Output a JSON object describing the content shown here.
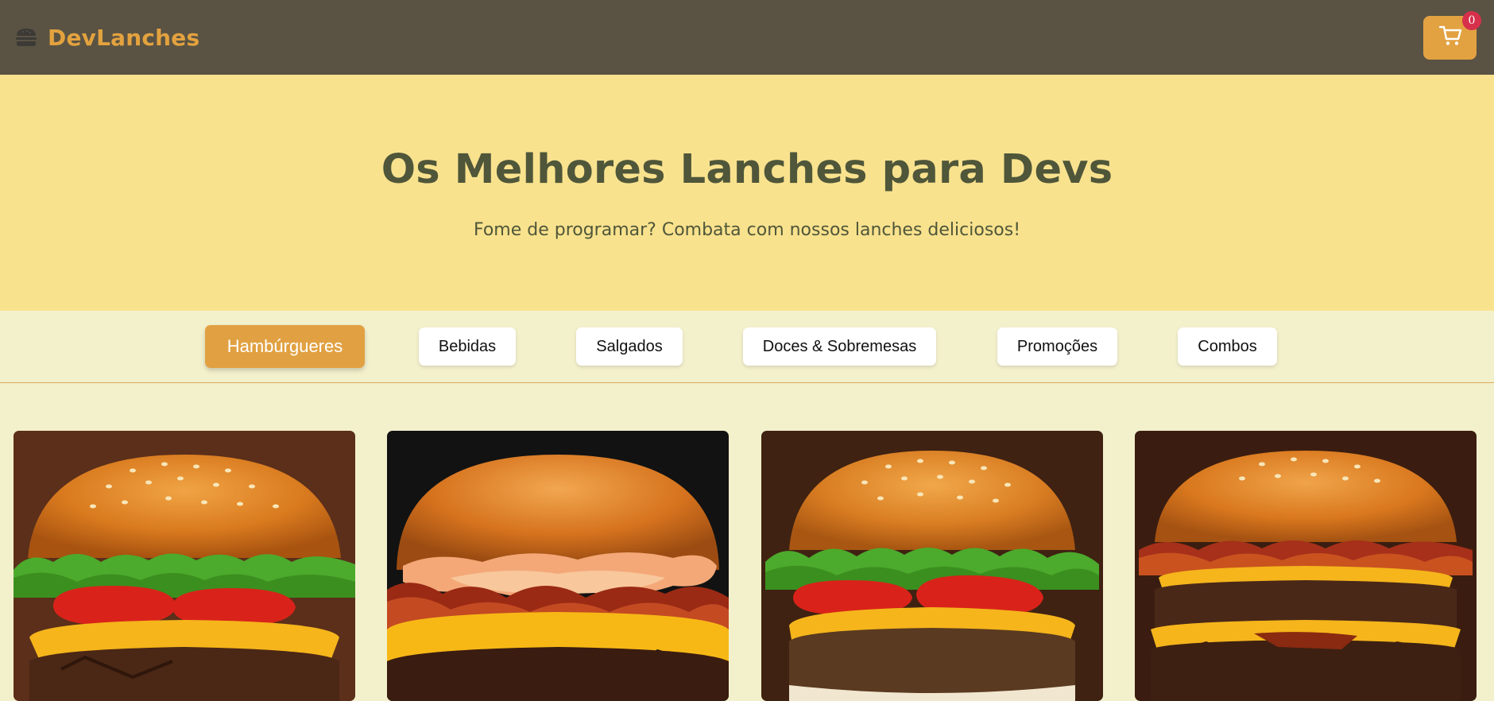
{
  "header": {
    "brand_name": "DevLanches",
    "brand_icon": "burger-icon",
    "cart_icon": "cart-icon",
    "cart_count": "0"
  },
  "hero": {
    "title": "Os Melhores Lanches para Devs",
    "subtitle": "Fome de programar? Combata com nossos lanches deliciosos!"
  },
  "categories": [
    {
      "label": "Hambúrgueres",
      "active": true
    },
    {
      "label": "Bebidas",
      "active": false
    },
    {
      "label": "Salgados",
      "active": false
    },
    {
      "label": "Doces & Sobremesas",
      "active": false
    },
    {
      "label": "Promoções",
      "active": false
    },
    {
      "label": "Combos",
      "active": false
    }
  ],
  "products": [
    {
      "image": "burger-photo-lettuce-tomato-cheese"
    },
    {
      "image": "burger-photo-bacon-sauce-cheese"
    },
    {
      "image": "burger-photo-lettuce-tomato-cheese"
    },
    {
      "image": "burger-photo-double-bacon-cheese"
    }
  ],
  "colors": {
    "header_bg": "#5a5344",
    "accent": "#e2a241",
    "hero_bg": "#f9e28e",
    "page_bg": "#f3f0cc",
    "text_dark": "#4f5639",
    "badge": "#d6304a"
  }
}
